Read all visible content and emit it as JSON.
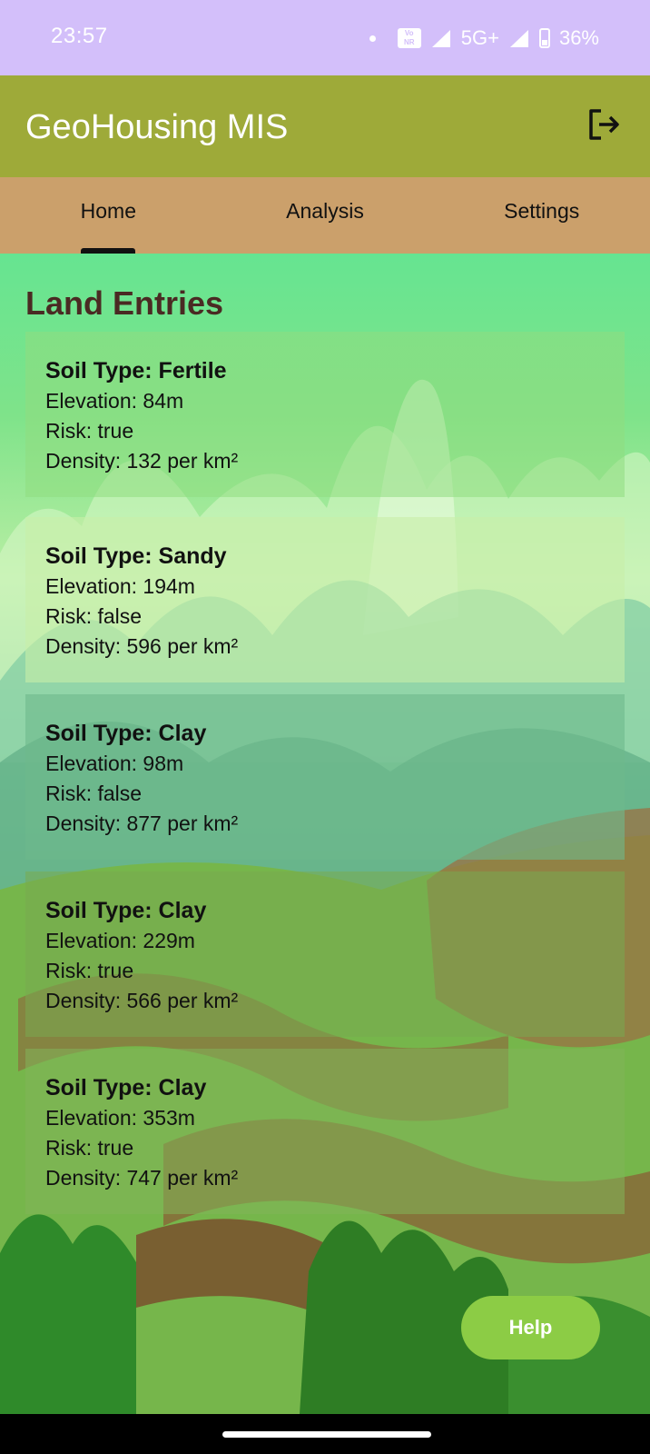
{
  "status_bar": {
    "time": "23:57",
    "network": "5G+",
    "battery": "36%",
    "icons": [
      "notification-dot-icon",
      "volte-icon",
      "signal-icon",
      "battery-icon"
    ]
  },
  "app_bar": {
    "title": "GeoHousing MIS",
    "logout_icon": "logout-icon"
  },
  "tabs": [
    {
      "label": "Home",
      "selected": true
    },
    {
      "label": "Analysis",
      "selected": false
    },
    {
      "label": "Settings",
      "selected": false
    }
  ],
  "section_title": "Land Entries",
  "entries": [
    {
      "soil": "Soil Type: Fertile",
      "elevation": "Elevation: 84m",
      "risk": "Risk: true",
      "density": "Density: 132 per km²"
    },
    {
      "soil": "Soil Type: Sandy",
      "elevation": "Elevation: 194m",
      "risk": "Risk: false",
      "density": "Density: 596 per km²"
    },
    {
      "soil": "Soil Type: Clay",
      "elevation": "Elevation: 98m",
      "risk": "Risk: false",
      "density": "Density: 877 per km²"
    },
    {
      "soil": "Soil Type: Clay",
      "elevation": "Elevation: 229m",
      "risk": "Risk: true",
      "density": "Density: 566 per km²"
    },
    {
      "soil": "Soil Type: Clay",
      "elevation": "Elevation: 353m",
      "risk": "Risk: true",
      "density": "Density: 747 per km²"
    }
  ],
  "help_button": "Help",
  "colors": {
    "status_bar": "#d3bffa",
    "app_bar": "#9eaa39",
    "tab_bar": "#cba06b",
    "section_title": "#4a2a23",
    "help_button": "#8ccc45"
  }
}
